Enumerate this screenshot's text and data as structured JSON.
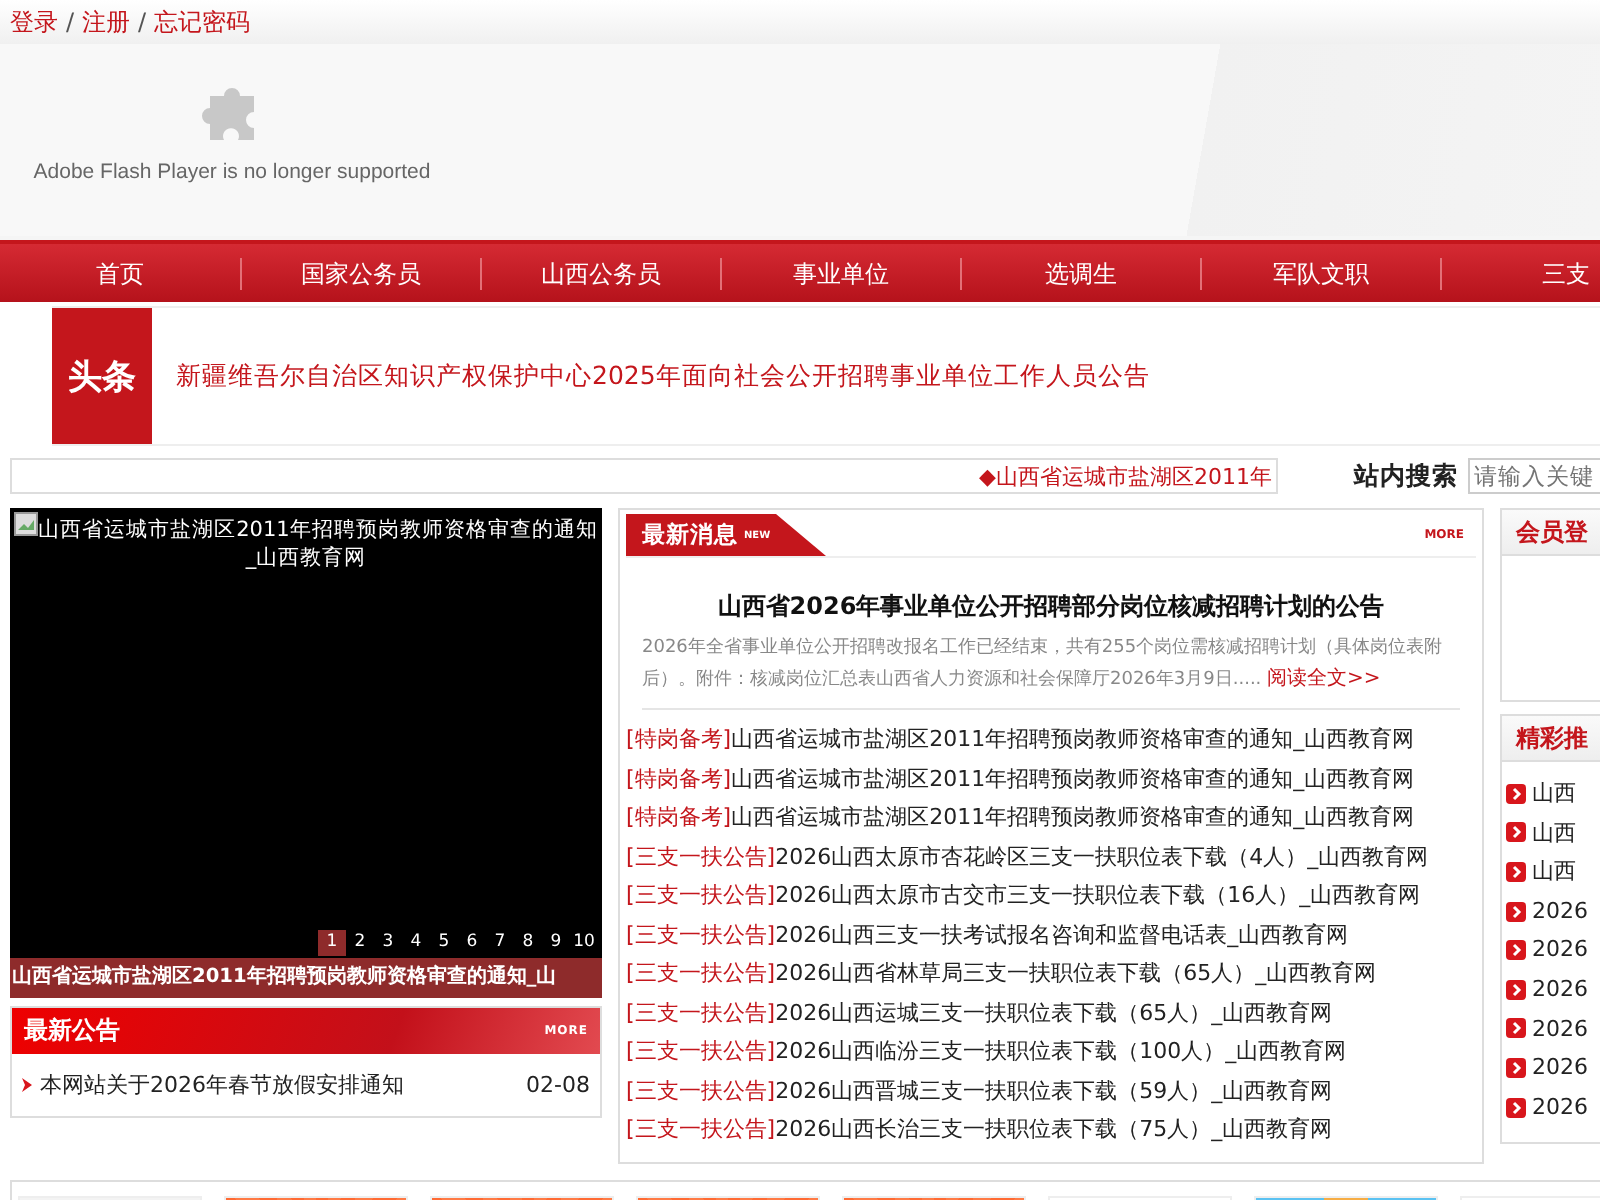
{
  "top_links": {
    "items": [
      "登录",
      "注册",
      "忘记密码"
    ],
    "separator": "/"
  },
  "flash": {
    "message": "Adobe Flash Player is no longer supported"
  },
  "nav": {
    "items": [
      "首页",
      "国家公务员",
      "山西公务员",
      "事业单位",
      "选调生",
      "军队文职",
      "三支"
    ]
  },
  "headline": {
    "badge": "头条",
    "title": "新疆维吾尔自治区知识产权保护中心2025年面向社会公开招聘事业单位工作人员公告"
  },
  "ticker": {
    "text": "◆山西省运城市盐湖区2011年"
  },
  "search": {
    "label": "站内搜索",
    "placeholder": "请输入关键"
  },
  "slideshow": {
    "image_alt": "山西省运城市盐湖区2011年招聘预岗教师资格审查的通知_山西教育网",
    "caption": "山西省运城市盐湖区2011年招聘预岗教师资格审查的通知_山",
    "pages": [
      {
        "label": "1",
        "selected": true
      },
      {
        "label": "2",
        "selected": false
      },
      {
        "label": "3",
        "selected": false
      },
      {
        "label": "4",
        "selected": false
      },
      {
        "label": "5",
        "selected": false
      },
      {
        "label": "6",
        "selected": false
      },
      {
        "label": "7",
        "selected": false
      },
      {
        "label": "8",
        "selected": false
      },
      {
        "label": "9",
        "selected": false
      },
      {
        "label": "10",
        "selected": false
      }
    ]
  },
  "notices": {
    "title": "最新公告",
    "more": "MORE",
    "items": [
      {
        "title": "本网站关于2026年春节放假安排通知",
        "date": "02-08"
      }
    ]
  },
  "news": {
    "title": "最新消息",
    "badge": "NEW",
    "more": "MORE",
    "featured": {
      "title": "山西省2026年事业单位公开招聘部分岗位核减招聘计划的公告",
      "summary": "2026年全省事业单位公开招聘改报名工作已经结束，共有255个岗位需核减招聘计划（具体岗位表附后）。附件：核减岗位汇总表山西省人力资源和社会保障厅2026年3月9日.....",
      "link": "阅读全文>>"
    },
    "items": [
      {
        "tag": "[特岗备考]",
        "title": "山西省运城市盐湖区2011年招聘预岗教师资格审查的通知_山西教育网"
      },
      {
        "tag": "[特岗备考]",
        "title": "山西省运城市盐湖区2011年招聘预岗教师资格审查的通知_山西教育网"
      },
      {
        "tag": "[特岗备考]",
        "title": "山西省运城市盐湖区2011年招聘预岗教师资格审查的通知_山西教育网"
      },
      {
        "tag": "[三支一扶公告]",
        "title": "2026山西太原市杏花岭区三支一扶职位表下载（4人）_山西教育网"
      },
      {
        "tag": "[三支一扶公告]",
        "title": "2026山西太原市古交市三支一扶职位表下载（16人）_山西教育网"
      },
      {
        "tag": "[三支一扶公告]",
        "title": "2026山西三支一扶考试报名咨询和监督电话表_山西教育网"
      },
      {
        "tag": "[三支一扶公告]",
        "title": "2026山西省林草局三支一扶职位表下载（65人）_山西教育网"
      },
      {
        "tag": "[三支一扶公告]",
        "title": "2026山西运城三支一扶职位表下载（65人）_山西教育网"
      },
      {
        "tag": "[三支一扶公告]",
        "title": "2026山西临汾三支一扶职位表下载（100人）_山西教育网"
      },
      {
        "tag": "[三支一扶公告]",
        "title": "2026山西晋城三支一扶职位表下载（59人）_山西教育网"
      },
      {
        "tag": "[三支一扶公告]",
        "title": "2026山西长治三支一扶职位表下载（75人）_山西教育网"
      }
    ]
  },
  "member": {
    "title": "会员登"
  },
  "recommend": {
    "title": "精彩推",
    "items": [
      "山西",
      "山西",
      "山西",
      "2026",
      "2026",
      "2026",
      "2026",
      "2026",
      "2026"
    ]
  },
  "bottom_tiles": [
    {
      "kind": "blank"
    },
    {
      "kind": "orange"
    },
    {
      "kind": "orange"
    },
    {
      "kind": "orange"
    },
    {
      "kind": "orange"
    },
    {
      "kind": "white"
    },
    {
      "kind": "blue"
    },
    {
      "kind": "white"
    }
  ]
}
